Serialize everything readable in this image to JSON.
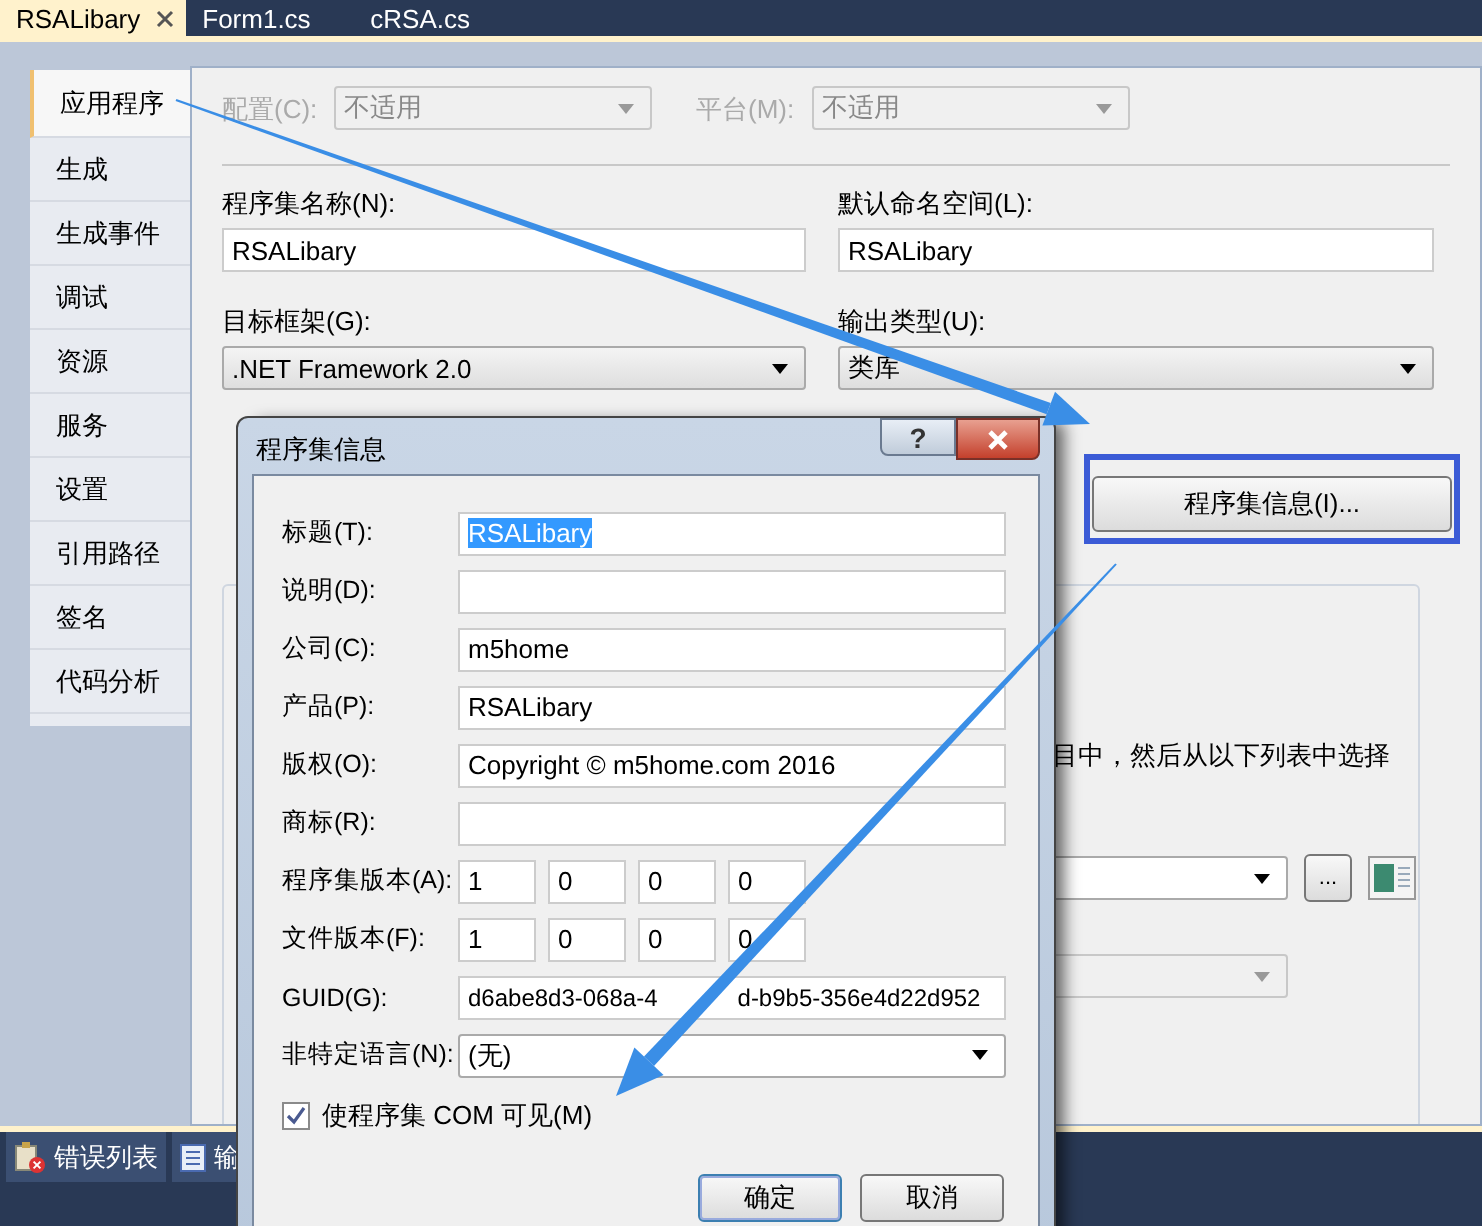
{
  "editor_tabs": [
    {
      "label": "RSALibary",
      "selected": true,
      "closable": true
    },
    {
      "label": "Form1.cs",
      "selected": false,
      "closable": false
    },
    {
      "label": "cRSA.cs",
      "selected": false,
      "closable": false
    }
  ],
  "sidebar": {
    "items": [
      {
        "label": "应用程序",
        "selected": true
      },
      {
        "label": "生成",
        "selected": false
      },
      {
        "label": "生成事件",
        "selected": false
      },
      {
        "label": "调试",
        "selected": false
      },
      {
        "label": "资源",
        "selected": false
      },
      {
        "label": "服务",
        "selected": false
      },
      {
        "label": "设置",
        "selected": false
      },
      {
        "label": "引用路径",
        "selected": false
      },
      {
        "label": "签名",
        "selected": false
      },
      {
        "label": "代码分析",
        "selected": false
      }
    ]
  },
  "config": {
    "disabled": true,
    "configuration_label": "配置(C):",
    "configuration_value": "不适用",
    "platform_label": "平台(M):",
    "platform_value": "不适用"
  },
  "fields": [
    {
      "kind": "text",
      "label": "程序集名称(N):",
      "value": "RSALibary"
    },
    {
      "kind": "text",
      "label": "默认命名空间(L):",
      "value": "RSALibary"
    },
    {
      "kind": "combo",
      "label": "目标框架(G):",
      "value": ".NET Framework 2.0"
    },
    {
      "kind": "combo",
      "label": "输出类型(U):",
      "value": "类库"
    }
  ],
  "assembly_info_button": {
    "label": "程序集信息(I)...",
    "highlighted": true
  },
  "resources_group": {
    "text": "目中，然后从以下列表中选择",
    "browse_button": "..."
  },
  "bottom_tabs": [
    {
      "label": "错误列表",
      "kind": "errors"
    },
    {
      "label": "输",
      "kind": "output"
    }
  ],
  "dialog": {
    "title": "程序集信息",
    "help_button": "?",
    "rows": [
      {
        "kind": "text",
        "label": "标题(T):",
        "value": "RSALibary",
        "highlighted": true
      },
      {
        "kind": "text",
        "label": "说明(D):"
      },
      {
        "kind": "text",
        "label": "公司(C):",
        "value": "m5home",
        "highlighted": false
      },
      {
        "kind": "text",
        "label": "产品(P):",
        "value": "RSALibary",
        "highlighted": false
      },
      {
        "kind": "text",
        "label": "版权(O):",
        "value": "Copyright © m5home.com 2016",
        "highlighted": false
      },
      {
        "kind": "text",
        "label": "商标(R):"
      },
      {
        "kind": "version",
        "label": "程序集版本(A):",
        "parts": [
          "1",
          "0",
          "0",
          "0"
        ]
      },
      {
        "kind": "version",
        "label": "文件版本(F):",
        "parts": [
          "1",
          "0",
          "0",
          "0"
        ]
      },
      {
        "kind": "split",
        "label": "GUID(G):",
        "parts": [
          "d6abe8d3-068a-4",
          "d-b9b5-356e4d22d952"
        ]
      },
      {
        "kind": "combo",
        "label": "非特定语言(N):",
        "value": "(无)"
      }
    ],
    "checkbox": {
      "label": "使程序集 COM 可见(M)",
      "checked": true
    },
    "buttons": [
      {
        "label": "确定",
        "default": true
      },
      {
        "label": "取消",
        "default": false
      }
    ]
  }
}
